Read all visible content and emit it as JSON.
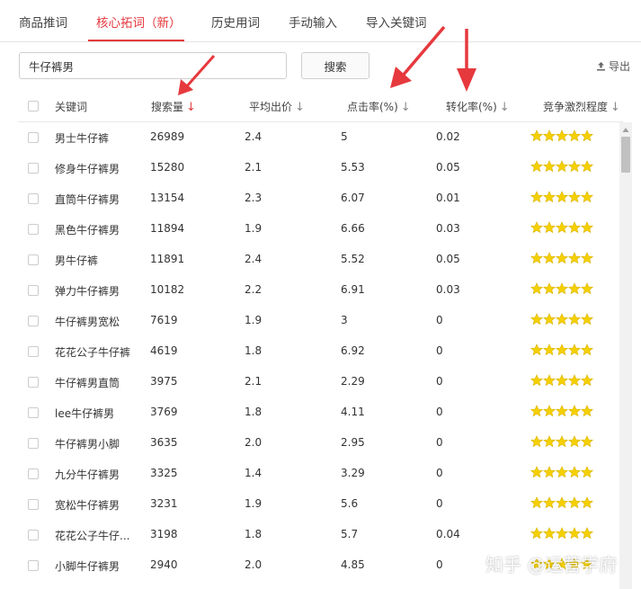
{
  "tabs": [
    {
      "label": "商品推词",
      "active": false
    },
    {
      "label": "核心拓词（新）",
      "active": true
    },
    {
      "label": "历史用词",
      "active": false
    },
    {
      "label": "手动输入",
      "active": false
    },
    {
      "label": "导入关键词",
      "active": false
    }
  ],
  "search": {
    "value": "牛仔裤男",
    "button_label": "搜索"
  },
  "export_label": "导出",
  "columns": {
    "keyword": "关键词",
    "search_volume": "搜索量",
    "avg_bid": "平均出价",
    "ctr": "点击率(%)",
    "conversion": "转化率(%)",
    "competition": "竞争激烈程度"
  },
  "sort_arrow": "↓",
  "colors": {
    "accent": "#e6393d",
    "star": "#f5d000"
  },
  "rows": [
    {
      "keyword": "男士牛仔裤",
      "volume": "26989",
      "bid": "2.4",
      "ctr": "5",
      "conv": "0.02",
      "stars": 5
    },
    {
      "keyword": "修身牛仔裤男",
      "volume": "15280",
      "bid": "2.1",
      "ctr": "5.53",
      "conv": "0.05",
      "stars": 5
    },
    {
      "keyword": "直筒牛仔裤男",
      "volume": "13154",
      "bid": "2.3",
      "ctr": "6.07",
      "conv": "0.01",
      "stars": 5
    },
    {
      "keyword": "黑色牛仔裤男",
      "volume": "11894",
      "bid": "1.9",
      "ctr": "6.66",
      "conv": "0.03",
      "stars": 5
    },
    {
      "keyword": "男牛仔裤",
      "volume": "11891",
      "bid": "2.4",
      "ctr": "5.52",
      "conv": "0.05",
      "stars": 5
    },
    {
      "keyword": "弹力牛仔裤男",
      "volume": "10182",
      "bid": "2.2",
      "ctr": "6.91",
      "conv": "0.03",
      "stars": 5
    },
    {
      "keyword": "牛仔裤男宽松",
      "volume": "7619",
      "bid": "1.9",
      "ctr": "3",
      "conv": "0",
      "stars": 5
    },
    {
      "keyword": "花花公子牛仔裤",
      "volume": "4619",
      "bid": "1.8",
      "ctr": "6.92",
      "conv": "0",
      "stars": 5
    },
    {
      "keyword": "牛仔裤男直筒",
      "volume": "3975",
      "bid": "2.1",
      "ctr": "2.29",
      "conv": "0",
      "stars": 5
    },
    {
      "keyword": "lee牛仔裤男",
      "volume": "3769",
      "bid": "1.8",
      "ctr": "4.11",
      "conv": "0",
      "stars": 5
    },
    {
      "keyword": "牛仔裤男小脚",
      "volume": "3635",
      "bid": "2.0",
      "ctr": "2.95",
      "conv": "0",
      "stars": 5
    },
    {
      "keyword": "九分牛仔裤男",
      "volume": "3325",
      "bid": "1.4",
      "ctr": "3.29",
      "conv": "0",
      "stars": 5
    },
    {
      "keyword": "宽松牛仔裤男",
      "volume": "3231",
      "bid": "1.9",
      "ctr": "5.6",
      "conv": "0",
      "stars": 5
    },
    {
      "keyword": "花花公子牛仔...",
      "volume": "3198",
      "bid": "1.8",
      "ctr": "5.7",
      "conv": "0.04",
      "stars": 5
    },
    {
      "keyword": "小脚牛仔裤男",
      "volume": "2940",
      "bid": "2.0",
      "ctr": "4.85",
      "conv": "0",
      "stars": 5
    }
  ],
  "watermark": "知乎 @运营学府"
}
